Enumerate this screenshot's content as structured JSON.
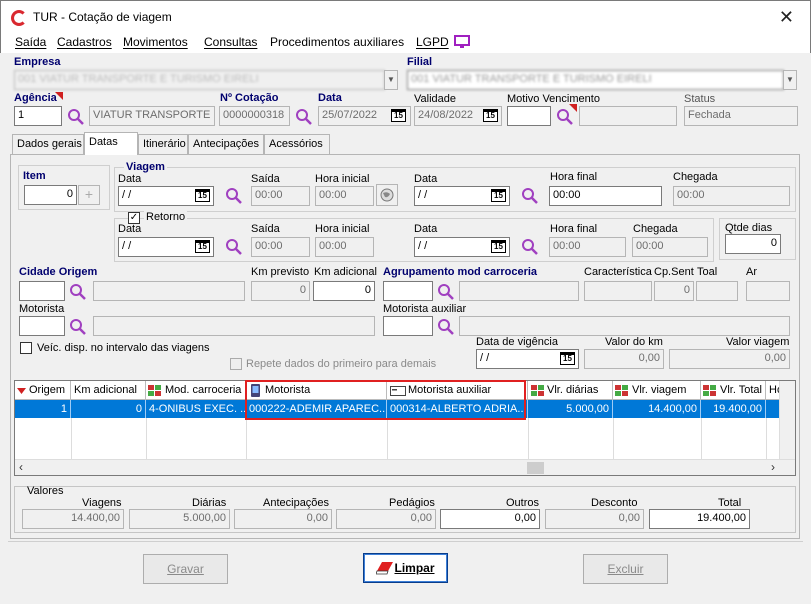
{
  "window": {
    "title": "TUR - Cotação de viagem",
    "close": "✕"
  },
  "menu": [
    {
      "label": "Saída"
    },
    {
      "label": "Cadastros"
    },
    {
      "label": "Movimentos"
    },
    {
      "label": "Consultas"
    },
    {
      "label": "Procedimentos auxiliares"
    },
    {
      "label": "LGPD"
    }
  ],
  "header": {
    "empresa_label": "Empresa",
    "empresa_value": "001 VIATUR TRANSPORTE E TURISMO EIRELI",
    "filial_label": "Filial",
    "filial_value": "001 VIATUR TRANSPORTE E TURISMO EIRELI",
    "agencia_label": "Agência",
    "agencia_code": "1",
    "agencia_name": "VIATUR TRANSPORTE E",
    "cotacao_label": "Nº Cotação",
    "cotacao_value": "0000000318",
    "data_label": "Data",
    "data_value": "25/07/2022",
    "validade_label": "Validade",
    "validade_value": "24/08/2022",
    "motivo_label": "Motivo Vencimento",
    "motivo_value": "",
    "status_label": "Status",
    "status_value": "Fechada"
  },
  "tabs": [
    {
      "label": "Dados gerais"
    },
    {
      "label": "Datas"
    },
    {
      "label": "Itinerário"
    },
    {
      "label": "Antecipações"
    },
    {
      "label": "Acessórios"
    }
  ],
  "datas": {
    "item_label": "Item",
    "item_value": "0",
    "viagem_label": "Viagem",
    "data_label": "Data",
    "saida_label": "Saída",
    "hora_inicial_label": "Hora inicial",
    "hora_final_label": "Hora final",
    "chegada_label": "Chegada",
    "date_blank": " / /",
    "time_blank": "00:00",
    "hora_final_value": "00:00",
    "retorno_label": "Retorno",
    "retorno_checked": "✓",
    "qtde_dias_label": "Qtde dias",
    "qtde_dias_value": "0",
    "cidade_origem_label": "Cidade Origem",
    "km_previsto_label": "Km previsto",
    "km_previsto_value": "0",
    "km_adicional_label": "Km adicional",
    "km_adicional_value": "0",
    "agrupamento_label": "Agrupamento mod carroceria",
    "caracteristica_label": "Característica",
    "cpsent_label": "Cp.Sent",
    "cpsent_value": "0",
    "toal_label": "Toal",
    "ar_label": "Ar",
    "motorista_label": "Motorista",
    "motorista_aux_label": "Motorista auxiliar",
    "veic_disp_label": "Veíc. disp. no intervalo das viagens",
    "repete_label": "Repete dados do primeiro para demais",
    "data_vigencia_label": "Data de vigência",
    "valor_km_label": "Valor do km",
    "valor_km_value": "0,00",
    "valor_viagem_label": "Valor viagem",
    "valor_viagem_value": "0,00"
  },
  "grid": {
    "columns": [
      "Origem",
      "Km adicional",
      "Mod. carroceria",
      "Motorista",
      "Motorista auxiliar",
      "Vlr. diárias",
      "Vlr. viagem",
      "Vlr. Total",
      "Ho"
    ],
    "rows": [
      [
        "1",
        "0",
        "4-ONIBUS EXEC. ...",
        "000222-ADEMIR APAREC...",
        "000314-ALBERTO ADRIA...",
        "5.000,00",
        "14.400,00",
        "19.400,00",
        ""
      ]
    ]
  },
  "valores": {
    "label": "Valores",
    "viagens_label": "Viagens",
    "viagens_value": "14.400,00",
    "diarias_label": "Diárias",
    "diarias_value": "5.000,00",
    "antecipacoes_label": "Antecipações",
    "antecipacoes_value": "0,00",
    "pedagios_label": "Pedágios",
    "pedagios_value": "0,00",
    "outros_label": "Outros",
    "outros_value": "0,00",
    "desconto_label": "Desconto",
    "desconto_value": "0,00",
    "total_label": "Total",
    "total_value": "19.400,00"
  },
  "buttons": {
    "gravar": "Gravar",
    "limpar": "Limpar",
    "excluir": "Excluir"
  },
  "colors": {
    "selection": "#0078d7",
    "highlight_box": "#e02020",
    "label_navy": "#00006e",
    "lookup_icon": "#a040c0"
  }
}
